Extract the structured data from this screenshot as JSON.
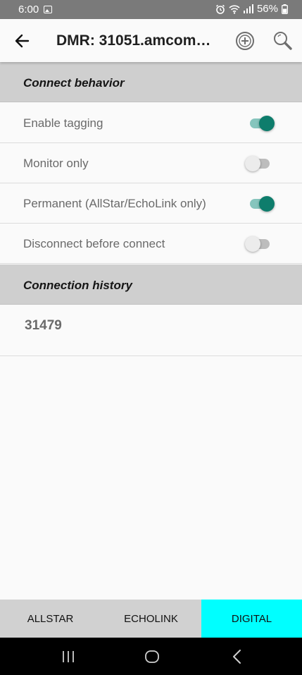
{
  "status_bar": {
    "time": "6:00",
    "battery": "56%",
    "icons": [
      "gallery-icon",
      "alarm-icon",
      "wifi-icon",
      "signal-icon",
      "battery-icon"
    ]
  },
  "app_bar": {
    "title": "DMR: 31051.amcomm.net...",
    "back_icon": "arrow-left-icon",
    "add_icon": "circle-plus-icon",
    "search_icon": "magnifier-icon"
  },
  "sections": {
    "connect_behavior": {
      "header": "Connect behavior",
      "rows": [
        {
          "label": "Enable tagging",
          "checked": true
        },
        {
          "label": "Monitor only",
          "checked": false
        },
        {
          "label": "Permanent (AllStar/EchoLink only)",
          "checked": true
        },
        {
          "label": "Disconnect before connect",
          "checked": false
        }
      ]
    },
    "connection_history": {
      "header": "Connection history",
      "items": [
        "31479"
      ]
    }
  },
  "bottom_tabs": [
    {
      "label": "ALLSTAR",
      "selected": false
    },
    {
      "label": "ECHOLINK",
      "selected": false
    },
    {
      "label": "DIGITAL",
      "selected": true
    }
  ],
  "colors": {
    "switch_on_thumb": "#0e7d6c",
    "switch_on_track": "#86c5bd",
    "selected_tab": "#00ffff",
    "section_header_bg": "#cfcfcf"
  }
}
